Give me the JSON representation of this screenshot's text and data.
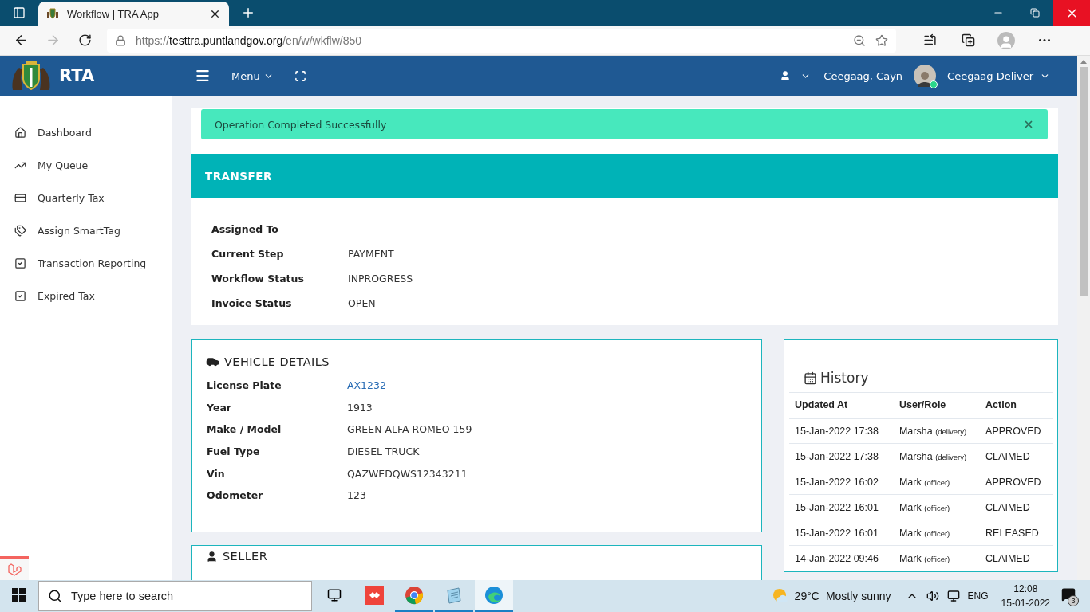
{
  "browser": {
    "tab_title": "Workflow | TRA App",
    "url": {
      "scheme": "https://",
      "host": "testtra.puntlandgov.org",
      "path": "/en/w/wkflw/850"
    }
  },
  "header": {
    "brand": "RTA",
    "menu_label": "Menu",
    "user_name": "Ceegaag, Cayn",
    "profile_name": "Ceegaag Deliver",
    "online": true
  },
  "sidebar": {
    "items": [
      {
        "kind": "home",
        "label": "Dashboard",
        "selected": false
      },
      {
        "kind": "trend",
        "label": "My Queue",
        "selected": false
      },
      {
        "kind": "list",
        "label": "Quarterly Tax",
        "selected": false
      },
      {
        "kind": "tags",
        "label": "Assign SmartTag",
        "selected": false
      },
      {
        "kind": "check",
        "label": "Transaction Reporting",
        "selected": false
      },
      {
        "kind": "check",
        "label": "Expired Tax",
        "selected": false
      }
    ]
  },
  "alert": {
    "message": "Operation Completed Successfully"
  },
  "transfer": {
    "title": "TRANSFER",
    "fields": [
      {
        "label": "Assigned To"
      },
      {
        "label": "Current Step",
        "value": "PAYMENT"
      },
      {
        "label": "Workflow Status",
        "value": "INPROGRESS"
      },
      {
        "label": "Invoice Status",
        "value": "OPEN"
      }
    ]
  },
  "vehicle_details": {
    "title": "VEHICLE DETAILS",
    "fields": [
      {
        "label": "License Plate",
        "value": "AX1232",
        "kind": "link"
      },
      {
        "label": "Year",
        "value": "1913"
      },
      {
        "label": "Make / Model",
        "value": "GREEN ALFA ROMEO 159"
      },
      {
        "label": "Fuel Type",
        "value": "DIESEL TRUCK"
      },
      {
        "label": "Vin",
        "value": "QAZWEDQWS12343211"
      },
      {
        "label": "Odometer",
        "value": "123"
      }
    ]
  },
  "history": {
    "title": "History",
    "columns": [
      "Updated At",
      "User/Role",
      "Action"
    ],
    "rows": [
      {
        "updated_at": "15-Jan-2022 17:38",
        "user": "Marsha",
        "role": "(delivery)",
        "action": "APPROVED"
      },
      {
        "updated_at": "15-Jan-2022 17:38",
        "user": "Marsha",
        "role": "(delivery)",
        "action": "CLAIMED"
      },
      {
        "updated_at": "15-Jan-2022 16:02",
        "user": "Mark",
        "role": "(officer)",
        "action": "APPROVED"
      },
      {
        "updated_at": "15-Jan-2022 16:01",
        "user": "Mark",
        "role": "(officer)",
        "action": "CLAIMED"
      },
      {
        "updated_at": "15-Jan-2022 16:01",
        "user": "Mark",
        "role": "(officer)",
        "action": "RELEASED"
      },
      {
        "updated_at": "14-Jan-2022 09:46",
        "user": "Mark",
        "role": "(officer)",
        "action": "CLAIMED"
      }
    ]
  },
  "seller": {
    "title": "SELLER"
  },
  "taskbar": {
    "search_placeholder": "Type here to search",
    "apps": [
      {
        "kind": "anydesk",
        "open": false,
        "selected": false
      },
      {
        "kind": "chrome",
        "open": true,
        "selected": false
      },
      {
        "kind": "notepad",
        "open": true,
        "selected": false
      },
      {
        "kind": "edge",
        "open": true,
        "selected": true
      }
    ],
    "temperature": "29°C",
    "weather": "Mostly sunny",
    "language": "ENG",
    "time": "12:08",
    "date": "15-01-2022",
    "notifications": "3"
  }
}
